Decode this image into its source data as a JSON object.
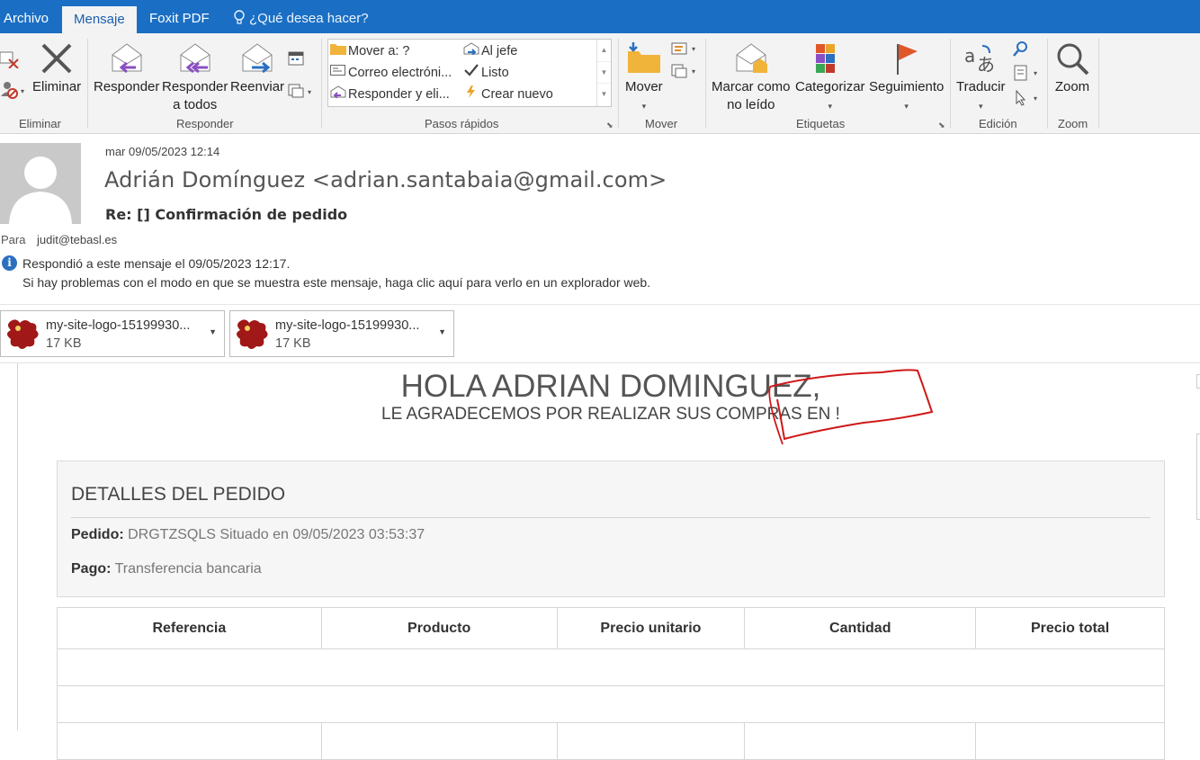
{
  "tabs": {
    "archivo": "Archivo",
    "mensaje": "Mensaje",
    "foxit": "Foxit PDF",
    "tell_me": "¿Qué desea hacer?"
  },
  "ribbon": {
    "groups": {
      "eliminar": "Eliminar",
      "responder": "Responder",
      "pasos_rapidos": "Pasos rápidos",
      "mover": "Mover",
      "etiquetas": "Etiquetas",
      "edicion": "Edición",
      "zoom": "Zoom"
    },
    "buttons": {
      "eliminar": "Eliminar",
      "responder": "Responder",
      "responder_todos_1": "Responder",
      "responder_todos_2": "a todos",
      "reenviar": "Reenviar",
      "mover": "Mover",
      "marcar_1": "Marcar como",
      "marcar_2": "no leído",
      "categorizar": "Categorizar",
      "seguimiento": "Seguimiento",
      "traducir": "Traducir",
      "zoom": "Zoom"
    },
    "quick_steps": [
      "Mover a: ?",
      "Correo electróni...",
      "Responder y eli...",
      "Al jefe",
      "Listo",
      "Crear nuevo"
    ],
    "accent": "#1a6fc4"
  },
  "message": {
    "date": "mar 09/05/2023 12:14",
    "from": "Adrián Domínguez <adrian.santabaia@gmail.com>",
    "subject": "Re: [] Confirmación de pedido",
    "to_label": "Para",
    "to": "judit@tebasl.es",
    "info_line1": "Respondió a este mensaje el 09/05/2023 12:17.",
    "info_line2": "Si hay problemas con el modo en que se muestra este mensaje, haga clic aquí para verlo en un explorador web."
  },
  "attachments": [
    {
      "name": "my-site-logo-15199930...",
      "size": "17 KB"
    },
    {
      "name": "my-site-logo-15199930...",
      "size": "17 KB"
    }
  ],
  "email_body": {
    "greeting": "HOLA ADRIAN DOMINGUEZ,",
    "subtitle": "LE AGRADECEMOS POR REALIZAR SUS COMPRAS EN !",
    "details_title": "DETALLES DEL PEDIDO",
    "pedido_label": "Pedido:",
    "pedido_value": "DRGTZSQLS Situado en 09/05/2023 03:53:37",
    "pago_label": "Pago:",
    "pago_value": "Transferencia bancaria",
    "table_headers": [
      "Referencia",
      "Producto",
      "Precio unitario",
      "Cantidad",
      "Precio total"
    ]
  }
}
